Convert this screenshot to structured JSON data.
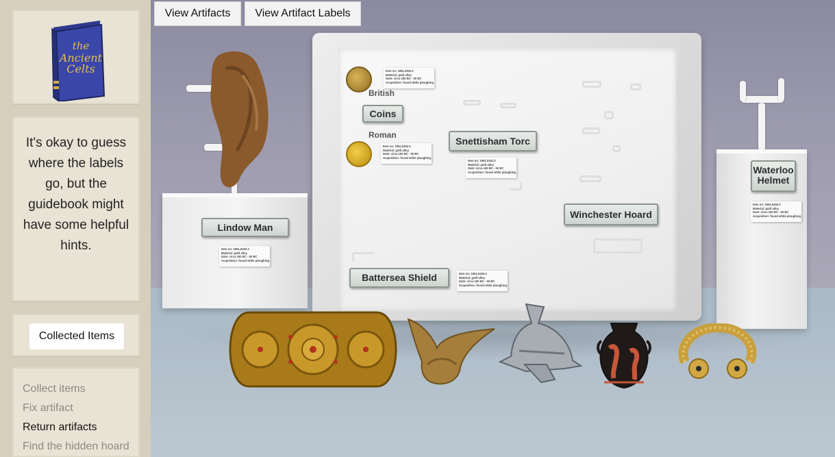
{
  "sidebar": {
    "book_title": "the Ancient Celts",
    "hint": "It's okay to guess where the labels go, but the guidebook might have some helpful hints.",
    "collected_button": "Collected Items",
    "tasks": [
      {
        "label": "Collect items",
        "status": "dim"
      },
      {
        "label": "Fix artifact",
        "status": "dim"
      },
      {
        "label": "Return artifacts",
        "status": "active"
      },
      {
        "label": "Find the hidden hoard",
        "status": "dim"
      }
    ]
  },
  "toolbar": {
    "view_artifacts": "View Artifacts",
    "view_labels": "View Artifact Labels"
  },
  "case": {
    "british_hint": "British",
    "roman_hint": "Roman"
  },
  "labels": {
    "lindow": "Lindow Man",
    "coins": "Coins",
    "snettisham": "Snettisham Torc",
    "winchester": "Winchester Hoard",
    "battersea": "Battersea Shield",
    "waterloo": "Waterloo Helmet"
  },
  "info_card": {
    "line1": "Item no: 1951,0402.2",
    "line2": "Material: gold alloy",
    "line3": "Date: circa 150 BC - 50 BC",
    "line4": "Acquisition: found while ploughing"
  },
  "colors": {
    "sidebar_bg": "#d6cfbe",
    "panel_bg": "#e8e3d4",
    "wall": "#9c9aad",
    "floor": "#b4c2cc",
    "label_border": "#8b9690"
  },
  "icons": [
    "guidebook-icon",
    "lindow-man-artifact",
    "battersea-shield-artifact",
    "horned-helmet-artifact",
    "gladiator-helmet-artifact",
    "greek-vase-artifact",
    "gold-torc-artifact",
    "british-coin",
    "roman-coin"
  ]
}
